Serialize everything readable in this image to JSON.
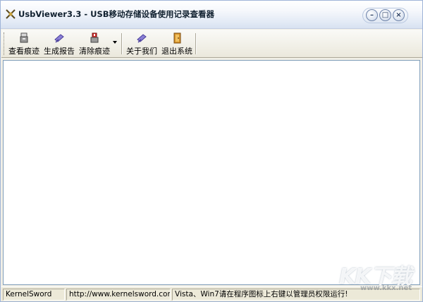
{
  "window": {
    "title": "UsbViewer3.3 - USB移动存储设备使用记录查看器"
  },
  "toolbar": {
    "buttons": [
      {
        "label": "查看痕迹",
        "icon": "usb-drive-icon"
      },
      {
        "label": "生成报告",
        "icon": "report-flag-icon"
      },
      {
        "label": "清除痕迹",
        "icon": "clear-usb-icon"
      },
      {
        "label": "关于我们",
        "icon": "about-flag-icon"
      },
      {
        "label": "退出系统",
        "icon": "exit-door-icon"
      }
    ]
  },
  "statusbar": {
    "pane1": "KernelSword",
    "pane2": "http://www.kernelsword.com",
    "pane3": "Vista、Win7请在程序图标上右键以管理员权限运行!"
  },
  "watermark": {
    "text": "KK下载",
    "url": "www.kkx.net"
  }
}
